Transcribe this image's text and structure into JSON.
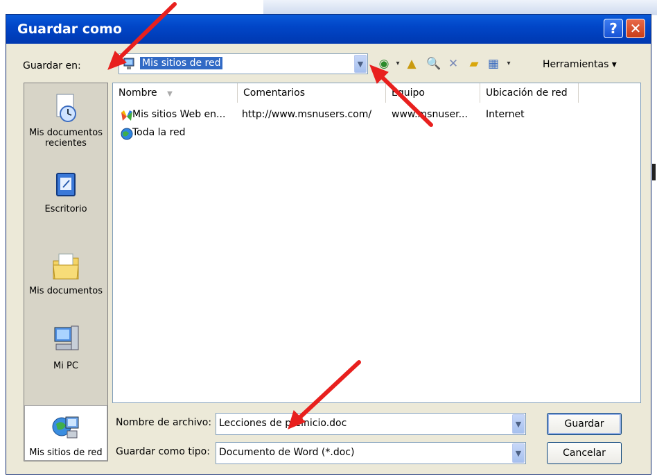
{
  "dialog": {
    "title": "Guardar como",
    "help_glyph": "?",
    "close_glyph": "✕"
  },
  "location": {
    "label": "Guardar en:",
    "value": "Mis sitios de red",
    "tools_label": "Herramientas ▾"
  },
  "places": [
    {
      "label": "Mis documentos recientes",
      "icon": "recent-documents-icon"
    },
    {
      "label": "Escritorio",
      "icon": "desktop-icon"
    },
    {
      "label": "Mis documentos",
      "icon": "my-documents-icon"
    },
    {
      "label": "Mi PC",
      "icon": "my-computer-icon"
    },
    {
      "label": "Mis sitios de red",
      "icon": "network-places-icon"
    }
  ],
  "columns": [
    "Nombre",
    "Comentarios",
    "Equipo",
    "Ubicación de red"
  ],
  "rows": [
    {
      "name": "Mis sitios Web en...",
      "comment": "http://www.msnusers.com/",
      "computer": "www.msnuser...",
      "location": "Internet"
    },
    {
      "name": "Toda la red",
      "comment": "",
      "computer": "",
      "location": ""
    }
  ],
  "filename": {
    "label": "Nombre de archivo:",
    "value": "Lecciones de preinicio.doc"
  },
  "filetype": {
    "label": "Guardar como tipo:",
    "value": "Documento de Word (*.doc)"
  },
  "buttons": {
    "save": "Guardar",
    "cancel": "Cancelar"
  },
  "colors": {
    "titlebar": "#0146c8",
    "dialog_bg": "#ece9d8",
    "selection": "#316ac5",
    "annotation_arrow": "#e8201e"
  }
}
